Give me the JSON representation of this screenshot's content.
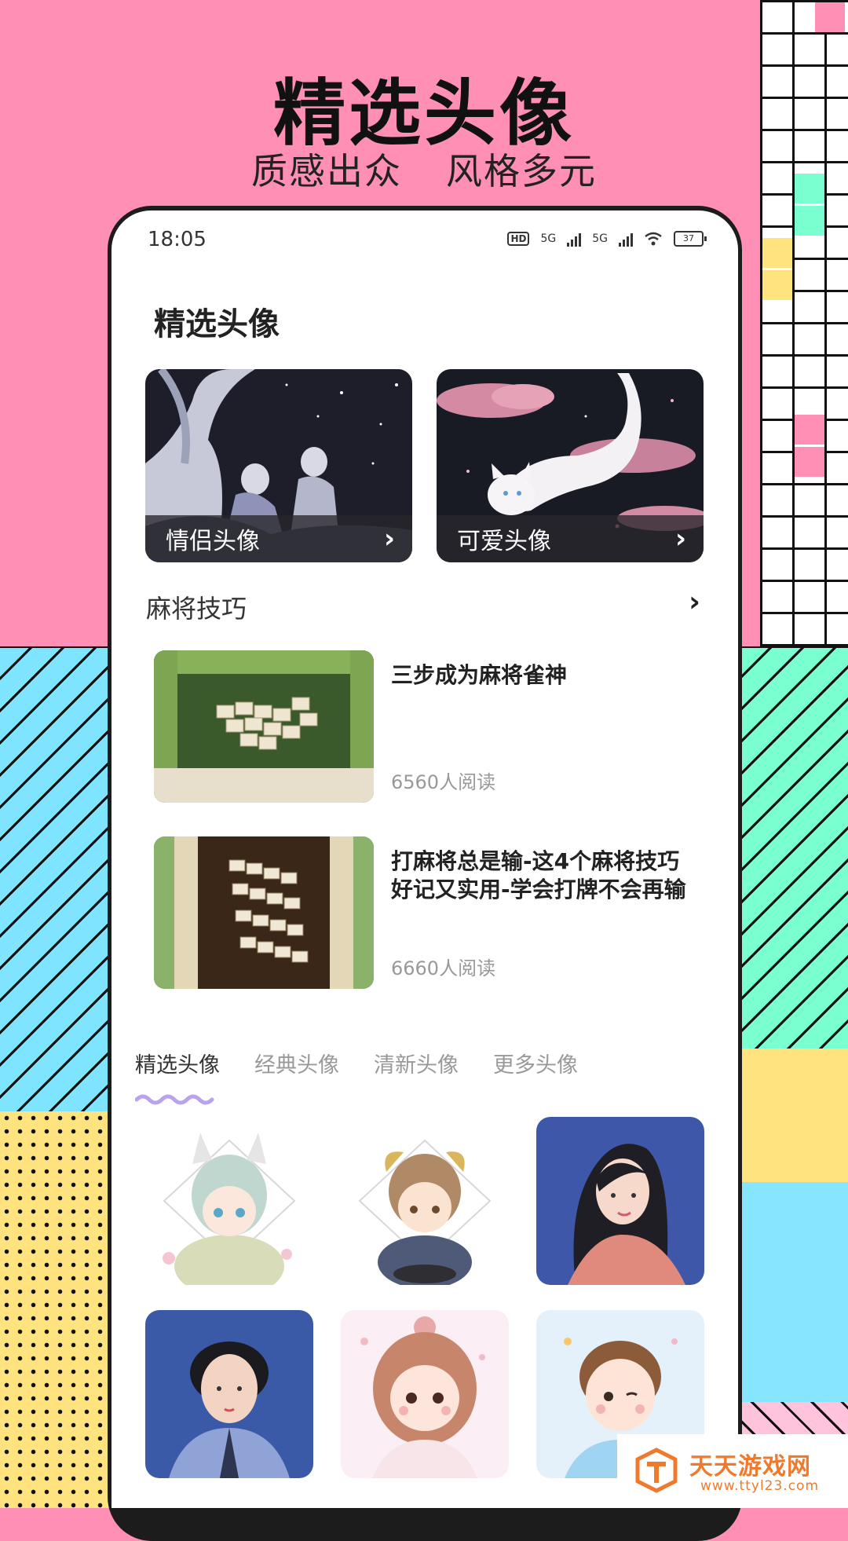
{
  "hero": {
    "title": "精选头像",
    "subtitle_left": "质感出众",
    "subtitle_right": "风格多元"
  },
  "status_bar": {
    "time": "18:05",
    "network_left": "5G",
    "network_right": "5G",
    "hd_badge": "HD",
    "battery": "37"
  },
  "page": {
    "title": "精选头像"
  },
  "cards": [
    {
      "label": "情侣头像",
      "icon": "chevron-right-icon"
    },
    {
      "label": "可爱头像",
      "icon": "chevron-right-icon"
    }
  ],
  "tips_section": {
    "title": "麻将技巧",
    "arrow_icon": "chevron-right-icon"
  },
  "articles": [
    {
      "title": "三步成为麻将雀神",
      "reads": "6560人阅读"
    },
    {
      "title": "打麻将总是输-这4个麻将技巧好记又实用-学会打牌不会再输",
      "reads": "6660人阅读"
    }
  ],
  "tabs": [
    {
      "label": "精选头像",
      "active": true
    },
    {
      "label": "经典头像",
      "active": false
    },
    {
      "label": "清新头像",
      "active": false
    },
    {
      "label": "更多头像",
      "active": false
    }
  ],
  "watermark": {
    "name": "天天游戏网",
    "url": "www.ttyl23.com"
  },
  "colors": {
    "background_pink": "#ff8fb4",
    "accent_purple": "#b9a3f0",
    "watermark_orange": "#f07a2c"
  }
}
